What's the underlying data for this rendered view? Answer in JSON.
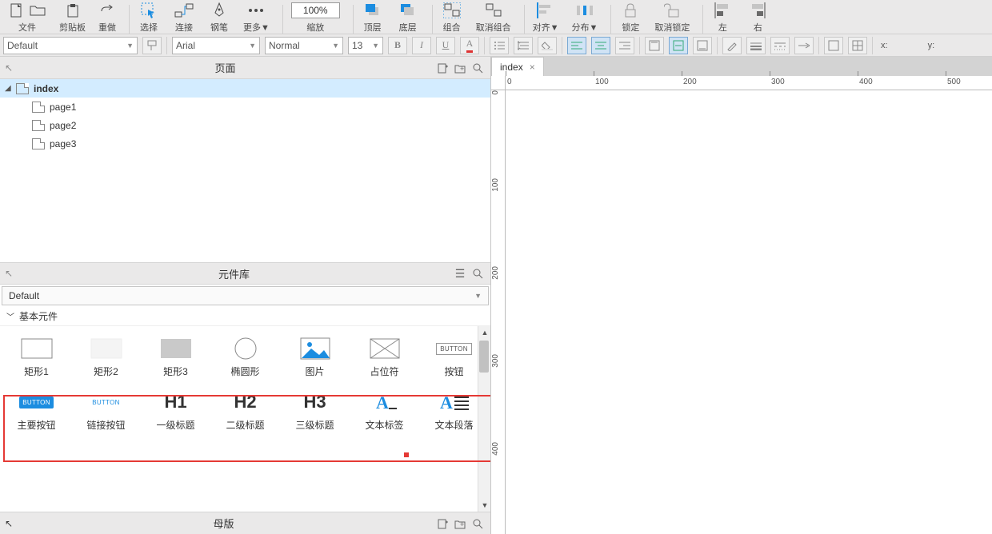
{
  "toolbar": {
    "file": "文件",
    "clipboard": "剪贴板",
    "redo": "重做",
    "select": "选择",
    "connect": "连接",
    "pen": "钢笔",
    "more": "更多▼",
    "zoom_value": "100%",
    "zoom_label": "缩放",
    "front": "顶层",
    "back": "底层",
    "group": "组合",
    "ungroup": "取消组合",
    "align": "对齐▼",
    "distribute": "分布▼",
    "lock": "锁定",
    "unlock": "取消锁定",
    "left": "左",
    "right": "右"
  },
  "formatbar": {
    "style_preset": "Default",
    "font": "Arial",
    "weight": "Normal",
    "size": "13",
    "x_label": "x:",
    "y_label": "y:"
  },
  "panels": {
    "pages_title": "页面",
    "library_title": "元件库",
    "master_title": "母版"
  },
  "pages": {
    "root": "index",
    "children": [
      "page1",
      "page2",
      "page3"
    ]
  },
  "library": {
    "preset": "Default",
    "section": "基本元件",
    "row1": [
      "矩形1",
      "矩形2",
      "矩形3",
      "椭圆形",
      "图片",
      "占位符",
      "按钮"
    ],
    "row2": [
      "主要按钮",
      "链接按钮",
      "一级标题",
      "二级标题",
      "三级标题",
      "文本标签",
      "文本段落"
    ],
    "h1": "H1",
    "h2": "H2",
    "h3": "H3",
    "btn_text": "BUTTON"
  },
  "canvas": {
    "tab": "index",
    "ruler_h": [
      "0",
      "100",
      "200",
      "300",
      "400",
      "500"
    ],
    "ruler_v": [
      "0",
      "100",
      "200",
      "300",
      "400"
    ]
  }
}
